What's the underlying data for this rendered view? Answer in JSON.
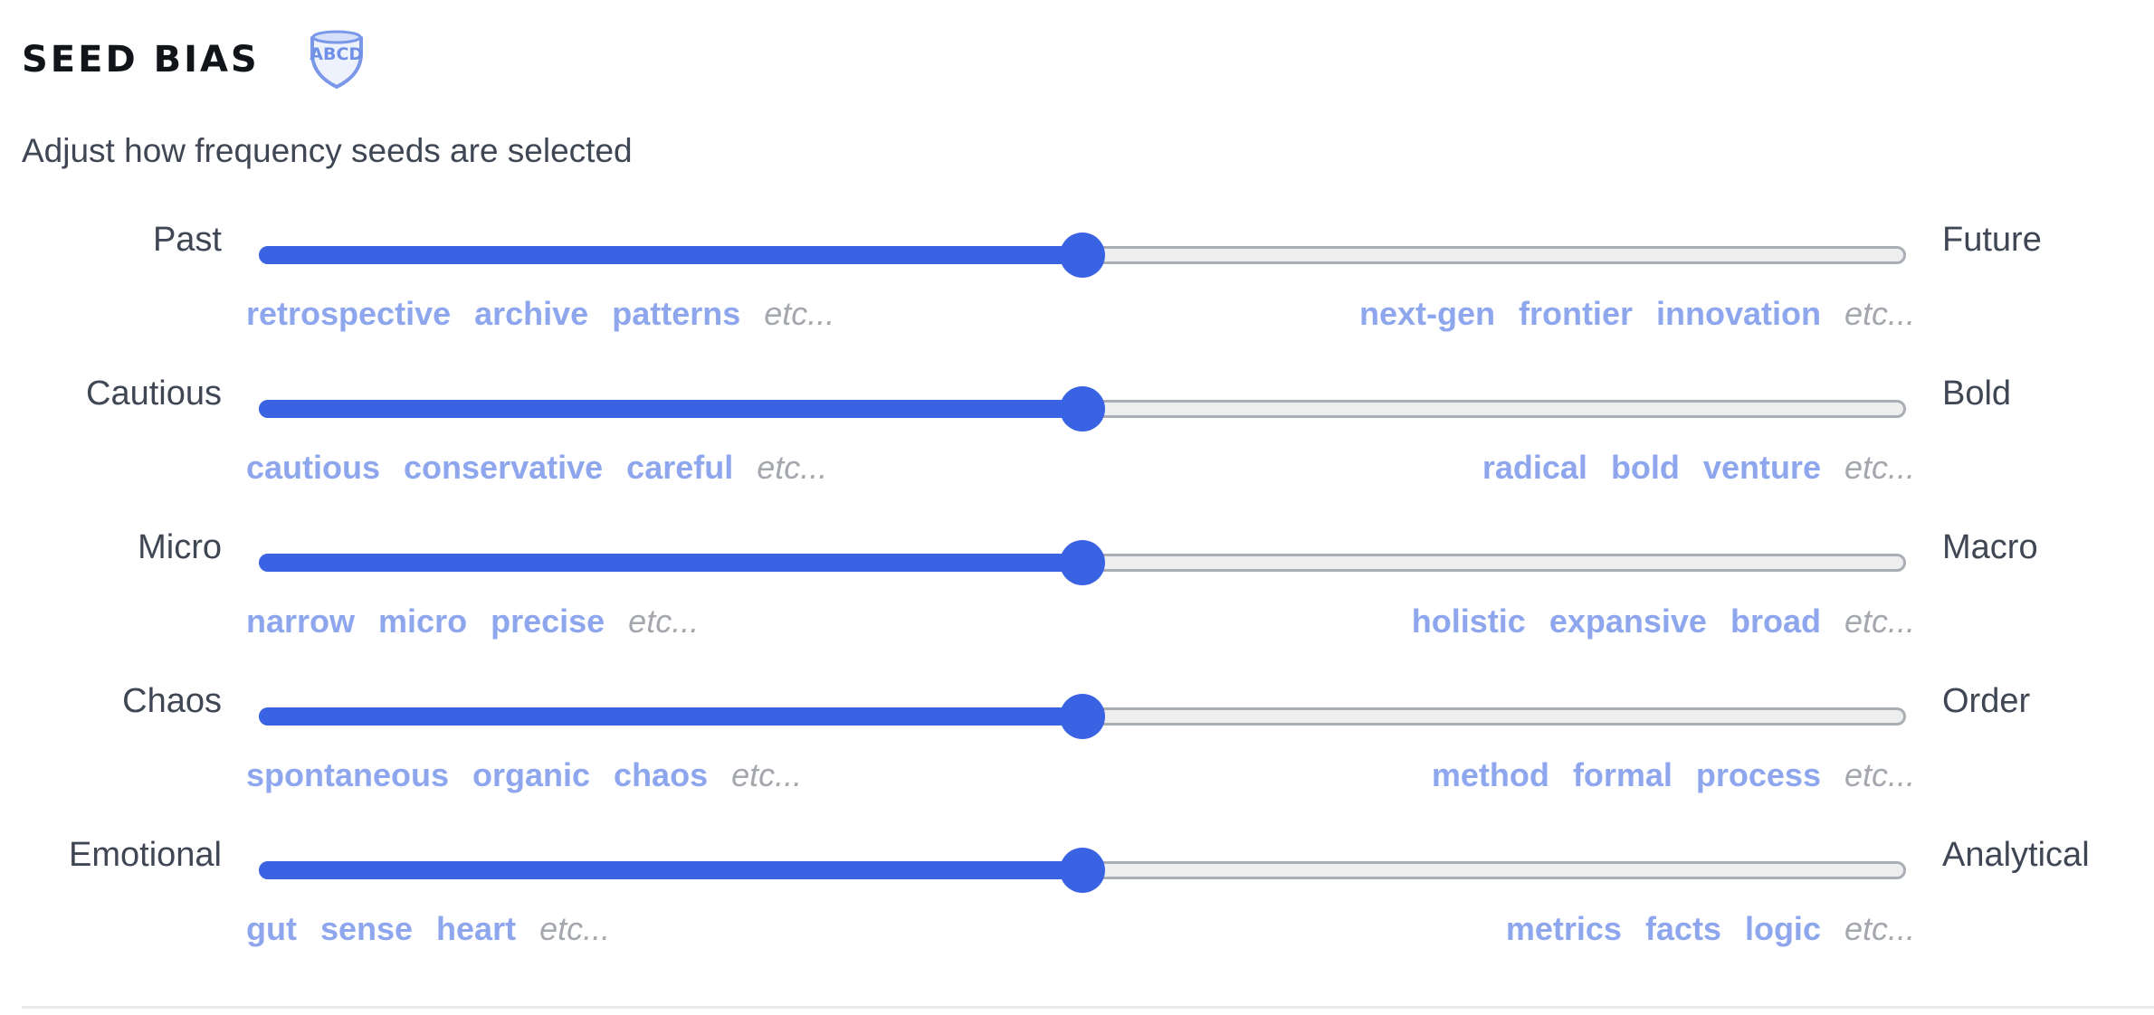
{
  "header": {
    "title": "SEED BIAS",
    "badge_text": "ABCD",
    "badge_icon": "shield-icon"
  },
  "subtitle": "Adjust how frequency seeds are selected",
  "colors": {
    "accent": "#3963e2",
    "tag": "#8ea6ed",
    "etc": "#a4a8ae",
    "track": "#eeeeee"
  },
  "sliders": [
    {
      "left_label": "Past",
      "right_label": "Future",
      "value": 0.5,
      "left_tags": [
        "retrospective",
        "archive",
        "patterns"
      ],
      "right_tags": [
        "next-gen",
        "frontier",
        "innovation"
      ],
      "etc": "etc..."
    },
    {
      "left_label": "Cautious",
      "right_label": "Bold",
      "value": 0.5,
      "left_tags": [
        "cautious",
        "conservative",
        "careful"
      ],
      "right_tags": [
        "radical",
        "bold",
        "venture"
      ],
      "etc": "etc..."
    },
    {
      "left_label": "Micro",
      "right_label": "Macro",
      "value": 0.5,
      "left_tags": [
        "narrow",
        "micro",
        "precise"
      ],
      "right_tags": [
        "holistic",
        "expansive",
        "broad"
      ],
      "etc": "etc..."
    },
    {
      "left_label": "Chaos",
      "right_label": "Order",
      "value": 0.5,
      "left_tags": [
        "spontaneous",
        "organic",
        "chaos"
      ],
      "right_tags": [
        "method",
        "formal",
        "process"
      ],
      "etc": "etc..."
    },
    {
      "left_label": "Emotional",
      "right_label": "Analytical",
      "value": 0.5,
      "left_tags": [
        "gut",
        "sense",
        "heart"
      ],
      "right_tags": [
        "metrics",
        "facts",
        "logic"
      ],
      "etc": "etc..."
    }
  ]
}
